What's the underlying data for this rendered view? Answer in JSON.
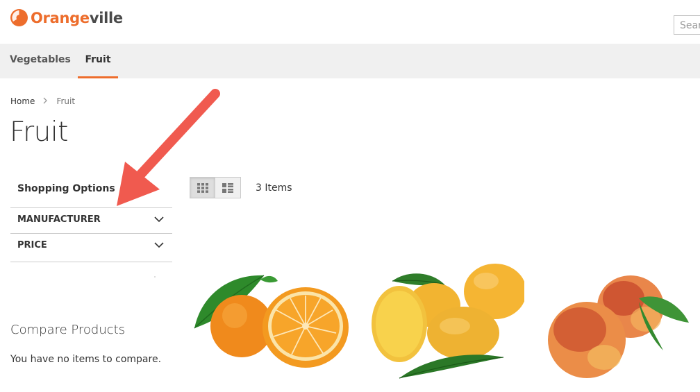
{
  "header": {
    "logo_part1": "Orange",
    "logo_part2": "ville",
    "search_placeholder": "Search entire store here..."
  },
  "nav": {
    "items": [
      {
        "label": "Vegetables"
      },
      {
        "label": "Fruit"
      }
    ]
  },
  "breadcrumb": {
    "home": "Home",
    "current": "Fruit"
  },
  "page": {
    "title": "Fruit"
  },
  "sidebar": {
    "title": "Shopping Options",
    "filters": [
      {
        "label": "MANUFACTURER",
        "icon": "chevron-down-icon"
      },
      {
        "label": "PRICE",
        "icon": "chevron-down-icon"
      }
    ],
    "compare_title": "Compare Products",
    "compare_empty": "You have no items to compare."
  },
  "toolbar": {
    "items_count": "3 Items",
    "modes": [
      "grid-icon",
      "list-icon"
    ],
    "active_mode": "grid"
  },
  "products": [
    {
      "image": "orange"
    },
    {
      "image": "mangoes"
    },
    {
      "image": "peaches"
    }
  ],
  "colors": {
    "brand": "#ed6d2c",
    "annotation_arrow": "#f05a4f"
  }
}
